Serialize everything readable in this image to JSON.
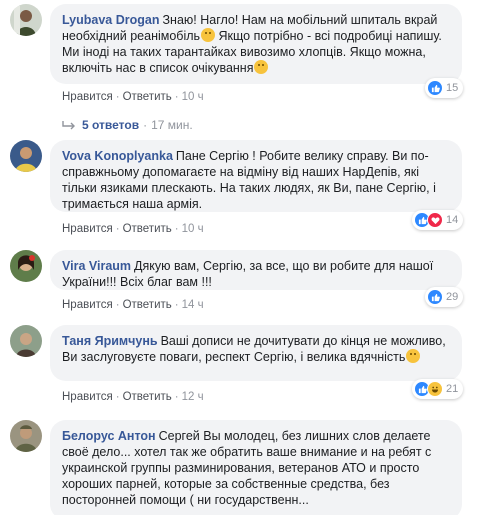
{
  "labels": {
    "like": "Нравится",
    "reply": "Ответить",
    "separator": "·"
  },
  "comments": [
    {
      "author": "Lyubava Drogan",
      "text": "Знаю! Нагло! Нам на мобільний шпиталь вкрай необхідний реанімобіль",
      "text2": " Якщо потрібно - всі подробиці напишу. Ми іноді на таких тарантайках вивозимо хлопців. Якщо можна, включіть нас в список очікування",
      "time": "10 ч",
      "reaction_count": "15",
      "reactions": [
        "like"
      ]
    },
    {
      "author": "Vova Konoplyanka",
      "text": "Пане Сергію ! Робите велику справу. Ви по-справжньому допомагаєте на відміну від наших НарДепів, які тільки язиками плескають. На таких людях, як Ви, пане Сергію, і тримається наша армія.",
      "time": "10 ч",
      "reaction_count": "14",
      "reactions": [
        "like",
        "love"
      ]
    },
    {
      "author": "Vira Viraum",
      "text": "Дякую вам, Сергію, за все, що ви робите для нашої України!!! Всіх благ вам !!!",
      "time": "14 ч",
      "reaction_count": "29",
      "reactions": [
        "like"
      ]
    },
    {
      "author": "Таня Яримчунь",
      "text": "Ваші дописи не дочитувати до кінця не можливо, Ви заслуговуєте поваги, респект Сергію, і велика вдячність",
      "time": "12 ч",
      "reaction_count": "21",
      "reactions": [
        "like",
        "haha"
      ]
    },
    {
      "author": "Белорус Антон",
      "text": "Сергей Вы молодец, без лишних слов делаете своё дело... хотел так же обратить ваше внимание и на ребят с украинской группы разминирования, ветеранов АТО и просто хороших парней, которые за собственные средства, без посторонней помощи ( ни государственн..."
    }
  ],
  "replies": {
    "label": "5 ответов",
    "time": "17 мин."
  },
  "colors": {
    "link": "#385898",
    "bubble": "#f2f3f5",
    "muted": "#90949c",
    "like": "#2d88ff",
    "love": "#f0284a",
    "haha": "#f7c33d"
  }
}
